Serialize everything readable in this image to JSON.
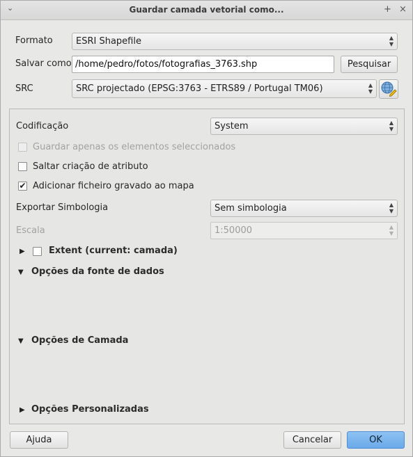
{
  "window": {
    "title": "Guardar camada vetorial como...",
    "menu_icon": "chevron-down-icon",
    "pin_icon": "pin-icon",
    "close_icon": "close-icon"
  },
  "top_form": {
    "formato_label": "Formato",
    "formato_value": "ESRI Shapefile",
    "salvar_label": "Salvar como",
    "salvar_value": "/home/pedro/fotos/fotografias_3763.shp",
    "pesquisar_label": "Pesquisar",
    "src_label": "SRC",
    "src_value": "SRC projectado (EPSG:3763 - ETRS89 / Portugal TM06)",
    "crs_icon": "crs-globe-icon"
  },
  "options": {
    "codificacao_label": "Codificação",
    "codificacao_value": "System",
    "guardar_apenas_label": "Guardar apenas os elementos seleccionados",
    "saltar_label": "Saltar criação de atributo",
    "adicionar_label": "Adicionar ficheiro gravado ao mapa",
    "simbologia_label": "Exportar Simbologia",
    "simbologia_value": "Sem simbologia",
    "escala_label": "Escala",
    "escala_value": "1:50000",
    "extent_label": "Extent (current: camada)",
    "fonte_label": "Opções da fonte de dados",
    "camada_label": "Opções de Camada",
    "personalizadas_label": "Opções Personalizadas"
  },
  "states": {
    "guardar_apenas_checked": false,
    "saltar_checked": false,
    "adicionar_checked": true,
    "extent_checked": false
  },
  "footer": {
    "ajuda_label": "Ajuda",
    "cancelar_label": "Cancelar",
    "ok_label": "OK"
  },
  "colors": {
    "ok_button": "#6aa9e9",
    "window_bg": "#e8e8e7"
  }
}
